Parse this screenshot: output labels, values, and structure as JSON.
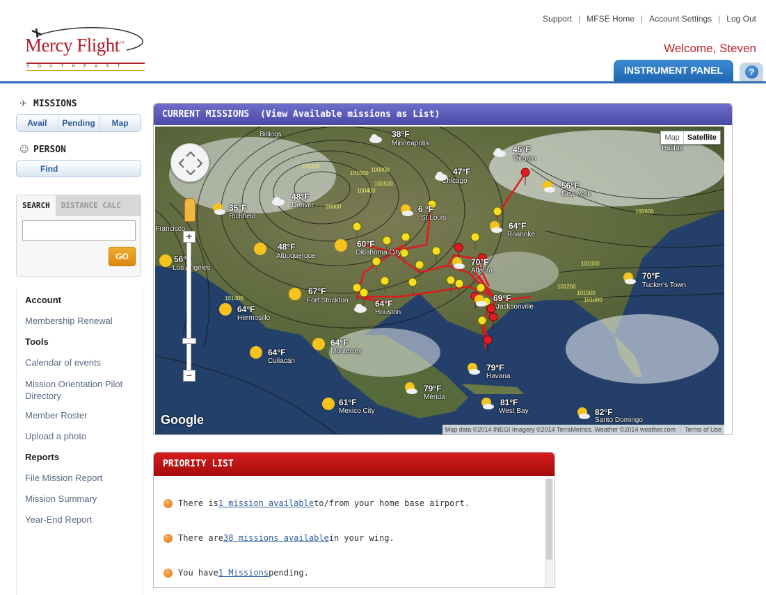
{
  "brand": {
    "name": "Mercy Flight",
    "tm": "™",
    "subtitle": "SOUTHEAST"
  },
  "top_links": {
    "support": "Support",
    "mfse_home": "MFSE Home",
    "account_settings": "Account Settings",
    "log_out": "Log Out",
    "separator": "|"
  },
  "welcome": "Welcome, Steven",
  "instrument_tab": "INSTRUMENT PANEL",
  "help_symbol": "?",
  "sidebar": {
    "missions_heading": "MISSIONS",
    "missions_buttons": [
      "Avail",
      "Pending",
      "Map"
    ],
    "person_heading": "PERSON",
    "person_button": "Find",
    "search_tab": "SEARCH",
    "distance_tab": "DISTANCE CALC",
    "search_value": "",
    "go_label": "GO",
    "links": [
      {
        "label": "Account",
        "heading": true
      },
      {
        "label": "Membership Renewal",
        "heading": false
      },
      {
        "label": "Tools",
        "heading": true
      },
      {
        "label": "Calendar of events",
        "heading": false
      },
      {
        "label": "Mission Orientation Pilot Directory",
        "heading": false
      },
      {
        "label": "Member Roster",
        "heading": false
      },
      {
        "label": "Upload a photo",
        "heading": false
      },
      {
        "label": "Reports",
        "heading": true
      },
      {
        "label": "File Mission Report",
        "heading": false
      },
      {
        "label": "Mission Summary",
        "heading": false
      },
      {
        "label": "Year-End Report",
        "heading": false
      }
    ]
  },
  "missions_panel": {
    "title": "CURRENT MISSIONS",
    "title_link": "(View Available missions as List)"
  },
  "map": {
    "type_map": "Map",
    "type_satellite": "Satellite",
    "zoom_in": "+",
    "zoom_out": "−",
    "google": "Google",
    "attribution": "Map data ©2014 INEGI Imagery ©2014 TerraMetrics, Weather ©2014 weather.com",
    "terms": "Terms of Use",
    "weather": [
      {
        "temp": "38°F",
        "city": "Minneapolis",
        "icon": "cloud"
      },
      {
        "temp": "45°F",
        "city": "Toronto",
        "icon": "cloud"
      },
      {
        "temp": "47°F",
        "city": "Chicago",
        "icon": "cloud"
      },
      {
        "temp": "56°F",
        "city": "New York",
        "icon": "sun-cloud"
      },
      {
        "temp": "48°F",
        "city": "Denver",
        "icon": "cloud"
      },
      {
        "temp": "35°F",
        "city": "Richfield",
        "icon": "sun-cloud"
      },
      {
        "temp": "6 °F",
        "city": "St Louis",
        "icon": "sun-cloud"
      },
      {
        "temp": "64°F",
        "city": "Roanoke",
        "icon": "sun-cloud"
      },
      {
        "temp": "48°F",
        "city": "Albuquerque",
        "icon": "sun"
      },
      {
        "temp": "60°F",
        "city": "Oklahoma City",
        "icon": "sun"
      },
      {
        "temp": "56°F",
        "city": "Los Angeles",
        "icon": "sun"
      },
      {
        "temp": "70°F",
        "city": "Atlanta",
        "icon": "sun-cloud"
      },
      {
        "temp": "70°F",
        "city": "Tucker's Town",
        "icon": "sun-cloud"
      },
      {
        "temp": "67°F",
        "city": "Fort Stockton",
        "icon": "sun"
      },
      {
        "temp": "64°F",
        "city": "Houston",
        "icon": "cloud"
      },
      {
        "temp": "69°F",
        "city": "Jacksonville",
        "icon": "sun-cloud"
      },
      {
        "temp": "64°F",
        "city": "Hermosillo",
        "icon": "sun"
      },
      {
        "temp": "64°F",
        "city": "Monterrey",
        "icon": "sun"
      },
      {
        "temp": "64°F",
        "city": "Culiacán",
        "icon": "sun"
      },
      {
        "temp": "79°F",
        "city": "Havana",
        "icon": "sun-cloud"
      },
      {
        "temp": "79°F",
        "city": "Mérida",
        "icon": "sun-cloud"
      },
      {
        "temp": "61°F",
        "city": "Mexico City",
        "icon": "sun"
      },
      {
        "temp": "81°F",
        "city": "West Bay",
        "icon": "sun-cloud"
      },
      {
        "temp": "82°F",
        "city": "Santo Domingo",
        "icon": "sun-cloud"
      }
    ],
    "place_labels": [
      "Billings",
      "Halifax",
      "Francisco"
    ],
    "pressure_labels": [
      "101200",
      "100800",
      "100500",
      "100400",
      "100200",
      "99800",
      "100600",
      "101600",
      "101500",
      "101000"
    ]
  },
  "priority": {
    "title": "PRIORITY LIST",
    "items": [
      {
        "before": "There is ",
        "link": "1 mission available",
        "after": " to/from your home base airport."
      },
      {
        "before": "There are ",
        "link": "38 missions available",
        "after": " in your wing."
      },
      {
        "before": "You have ",
        "link": "1 Missions",
        "after": " pending."
      }
    ]
  },
  "colors": {
    "accent_blue": "#2b6bb5",
    "brand_red": "#b01e28",
    "panel_purple": "#5a5ab8",
    "panel_red": "#c01414",
    "go_orange": "#e89a1c"
  }
}
